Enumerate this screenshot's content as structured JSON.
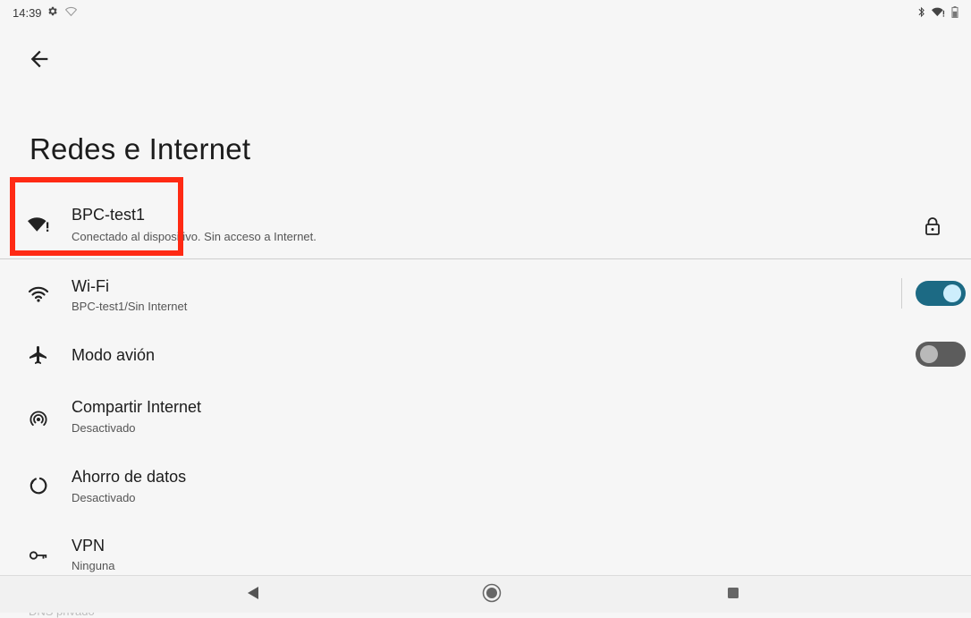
{
  "status_bar": {
    "time": "14:39",
    "left_icons": [
      "gear-icon",
      "wifi-outline-icon"
    ],
    "right_icons": [
      "bluetooth-icon",
      "wifi-alert-icon",
      "battery-icon"
    ]
  },
  "page": {
    "title": "Redes e Internet"
  },
  "connected_network": {
    "name": "BPC-test1",
    "status": "Conectado al dispositivo. Sin acceso a Internet.",
    "icon": "wifi-alert-icon",
    "trailing_icon": "lock-icon"
  },
  "settings": [
    {
      "id": "wifi",
      "title": "Wi-Fi",
      "subtitle": "BPC-test1/Sin Internet",
      "icon": "wifi-icon",
      "toggle": "on"
    },
    {
      "id": "airplane",
      "title": "Modo avión",
      "icon": "airplane-icon",
      "toggle": "off"
    },
    {
      "id": "hotspot",
      "title": "Compartir Internet",
      "subtitle": "Desactivado",
      "icon": "hotspot-icon"
    },
    {
      "id": "datasaver",
      "title": "Ahorro de datos",
      "subtitle": "Desactivado",
      "icon": "data-saver-icon"
    },
    {
      "id": "vpn",
      "title": "VPN",
      "subtitle": "Ninguna",
      "icon": "vpn-key-icon"
    }
  ],
  "next_item_peek": "DNS privado",
  "nav_bar": {
    "buttons": [
      "back",
      "home",
      "recents"
    ]
  },
  "colors": {
    "toggle_on": "#1c6a84",
    "toggle_off": "#5c5c5c",
    "highlight": "#ff2a14",
    "background": "#f6f6f6"
  }
}
